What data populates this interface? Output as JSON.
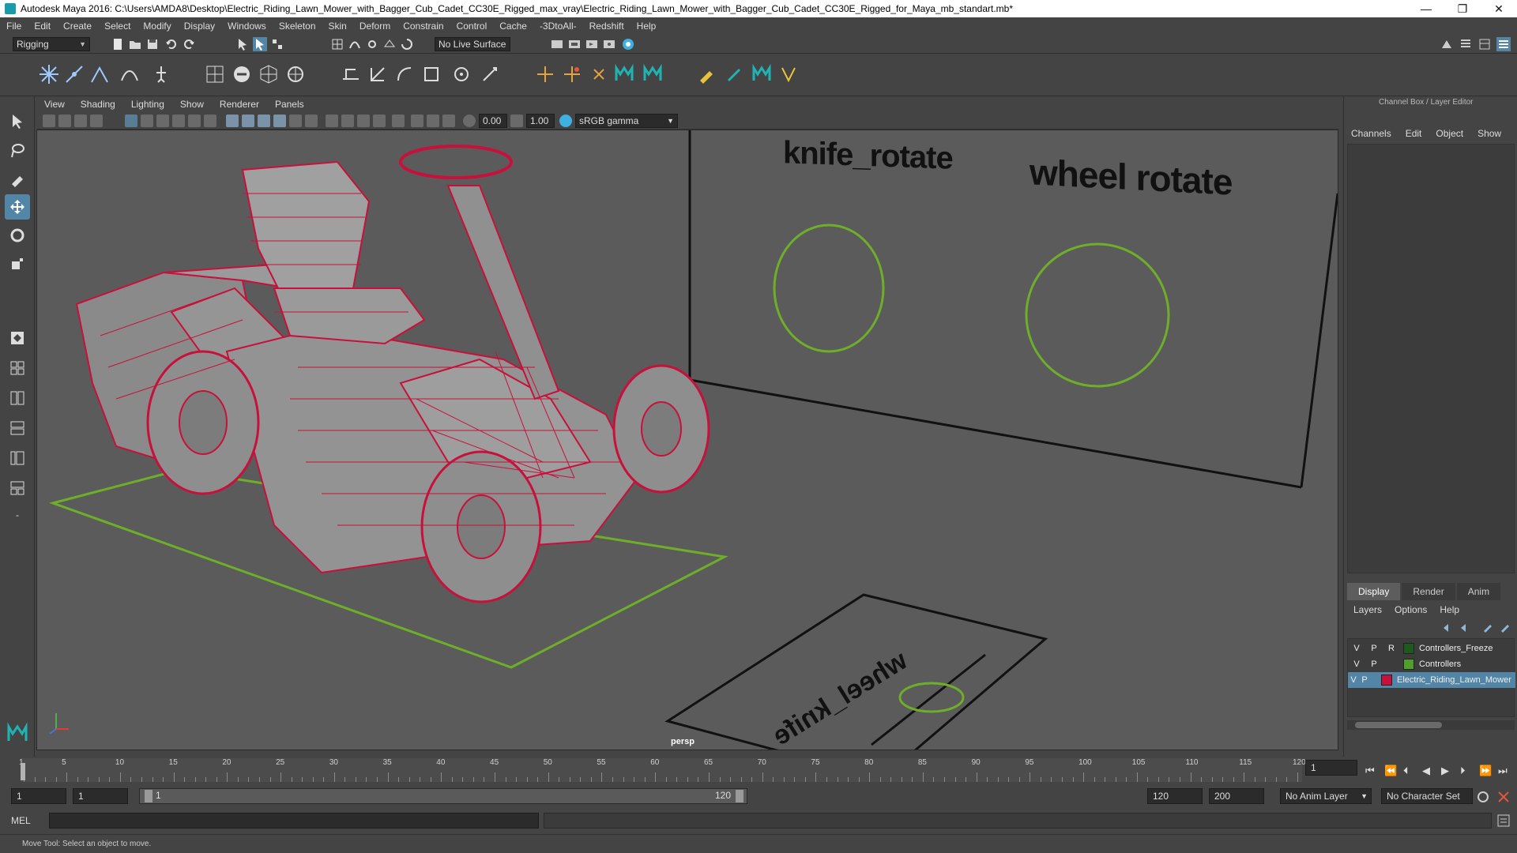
{
  "titlebar": {
    "title": "Autodesk Maya 2016: C:\\Users\\AMDA8\\Desktop\\Electric_Riding_Lawn_Mower_with_Bagger_Cub_Cadet_CC30E_Rigged_max_vray\\Electric_Riding_Lawn_Mower_with_Bagger_Cub_Cadet_CC30E_Rigged_for_Maya_mb_standart.mb*",
    "minimize": "—",
    "restore": "❐",
    "close": "✕"
  },
  "menubar": [
    "File",
    "Edit",
    "Create",
    "Select",
    "Modify",
    "Display",
    "Windows",
    "Skeleton",
    "Skin",
    "Deform",
    "Constrain",
    "Control",
    "Cache",
    "-3DtoAll-",
    "Redshift",
    "Help"
  ],
  "statusline": {
    "menu_set": "Rigging",
    "live_surface": "No Live Surface"
  },
  "viewport": {
    "menu": [
      "View",
      "Shading",
      "Lighting",
      "Show",
      "Renderer",
      "Panels"
    ],
    "exposure": "0.00",
    "gamma": "1.00",
    "color_space": "sRGB gamma",
    "camera_label": "persp",
    "labels": {
      "knife": "knife_rotate",
      "wheel": "wheel rotate",
      "floor": "wheel_knife"
    }
  },
  "channelbox": {
    "header": "Channel Box / Layer Editor",
    "menu": [
      "Channels",
      "Edit",
      "Object",
      "Show"
    ],
    "tabs": [
      "Display",
      "Render",
      "Anim"
    ],
    "active_tab": "Display",
    "layer_menu": [
      "Layers",
      "Options",
      "Help"
    ],
    "layers": [
      {
        "v": "V",
        "p": "P",
        "r": "R",
        "name": "Controllers_Freeze",
        "color": "#1e5a1e"
      },
      {
        "v": "V",
        "p": "P",
        "r": "",
        "name": "Controllers",
        "color": "#4fa02a"
      },
      {
        "v": "V",
        "p": "P",
        "r": "",
        "name": "Electric_Riding_Lawn_Mower",
        "color": "#c8103c"
      }
    ]
  },
  "timeslider": {
    "ticks": [
      1,
      5,
      10,
      15,
      20,
      25,
      30,
      35,
      40,
      45,
      50,
      55,
      60,
      65,
      70,
      75,
      80,
      85,
      90,
      95,
      100,
      105,
      110,
      115,
      120
    ],
    "current_frame": "1"
  },
  "rangeslider": {
    "start": "1",
    "playback_start": "1",
    "bar_start": "1",
    "bar_end": "120",
    "playback_end": "120",
    "end": "200",
    "anim_layer": "No Anim Layer",
    "character_set": "No Character Set"
  },
  "cmdline": {
    "label": "MEL"
  },
  "helpline": {
    "text": "Move Tool: Select an object to move."
  },
  "colors": {
    "mesh": "#c8103c",
    "controller": "#6fae2a",
    "accent": "#5285a6"
  }
}
